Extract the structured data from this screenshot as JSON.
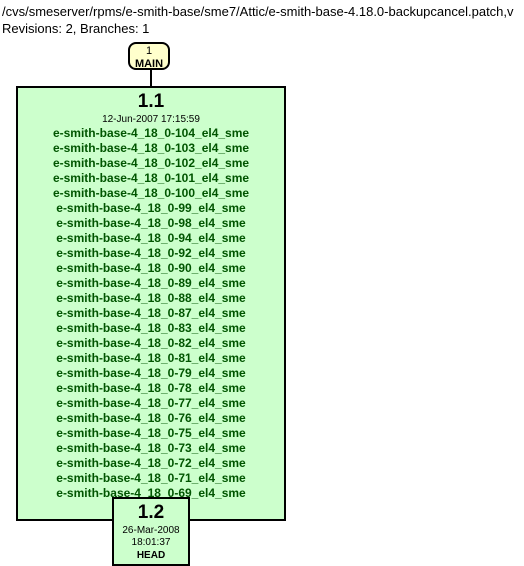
{
  "path": "/cvs/smeserver/rpms/e-smith-base/sme7/Attic/e-smith-base-4.18.0-backupcancel.patch,v",
  "revisions_line": "Revisions: 2, Branches: 1",
  "branch": {
    "num": "1",
    "name": "MAIN"
  },
  "rev11": {
    "num": "1.1",
    "date": "12-Jun-2007 17:15:59",
    "tags": [
      "e-smith-base-4_18_0-104_el4_sme",
      "e-smith-base-4_18_0-103_el4_sme",
      "e-smith-base-4_18_0-102_el4_sme",
      "e-smith-base-4_18_0-101_el4_sme",
      "e-smith-base-4_18_0-100_el4_sme",
      "e-smith-base-4_18_0-99_el4_sme",
      "e-smith-base-4_18_0-98_el4_sme",
      "e-smith-base-4_18_0-94_el4_sme",
      "e-smith-base-4_18_0-92_el4_sme",
      "e-smith-base-4_18_0-90_el4_sme",
      "e-smith-base-4_18_0-89_el4_sme",
      "e-smith-base-4_18_0-88_el4_sme",
      "e-smith-base-4_18_0-87_el4_sme",
      "e-smith-base-4_18_0-83_el4_sme",
      "e-smith-base-4_18_0-82_el4_sme",
      "e-smith-base-4_18_0-81_el4_sme",
      "e-smith-base-4_18_0-79_el4_sme",
      "e-smith-base-4_18_0-78_el4_sme",
      "e-smith-base-4_18_0-77_el4_sme",
      "e-smith-base-4_18_0-76_el4_sme",
      "e-smith-base-4_18_0-75_el4_sme",
      "e-smith-base-4_18_0-73_el4_sme",
      "e-smith-base-4_18_0-72_el4_sme",
      "e-smith-base-4_18_0-71_el4_sme",
      "e-smith-base-4_18_0-69_el4_sme"
    ],
    "ellipsis": "..."
  },
  "rev12": {
    "num": "1.2",
    "date": "26-Mar-2008 18:01:37",
    "head": "HEAD"
  }
}
